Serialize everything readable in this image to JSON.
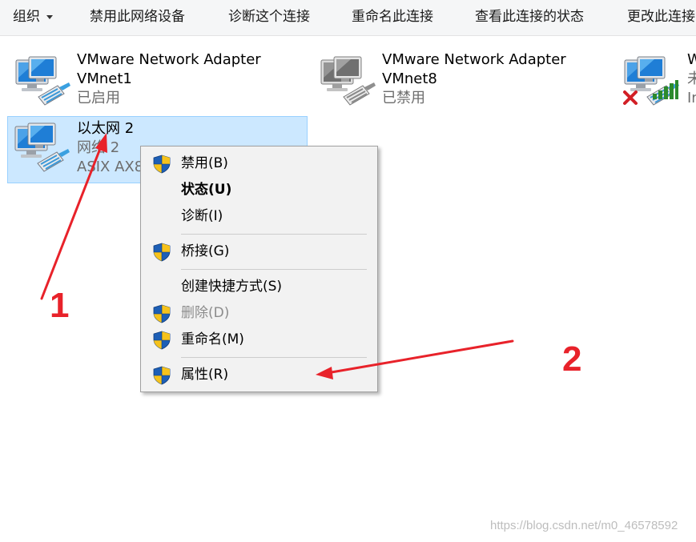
{
  "toolbar": {
    "organize": "组织",
    "disable": "禁用此网络设备",
    "diagnose": "诊断这个连接",
    "rename": "重命名此连接",
    "view_status": "查看此连接的状态",
    "change": "更改此连接"
  },
  "adapters": [
    {
      "name_line1": "VMware Network Adapter",
      "name_line2": "VMnet1",
      "status": "已启用"
    },
    {
      "name_line1": "VMware Network Adapter",
      "name_line2": "VMnet8",
      "status": "已禁用"
    },
    {
      "name_line1": "W",
      "status": "未",
      "detail": "In"
    },
    {
      "name": "以太网 2",
      "network": "网络 2",
      "device": "ASIX AX8"
    }
  ],
  "context_menu": {
    "items": [
      {
        "label": "禁用(B)",
        "shield": true
      },
      {
        "label": "状态(U)",
        "bold": true
      },
      {
        "label": "诊断(I)"
      },
      {
        "label": "桥接(G)",
        "shield": true
      },
      {
        "label": "创建快捷方式(S)"
      },
      {
        "label": "删除(D)",
        "shield": true,
        "disabled": true
      },
      {
        "label": "重命名(M)",
        "shield": true
      },
      {
        "label": "属性(R)",
        "shield": true
      }
    ]
  },
  "annotations": {
    "one": "1",
    "two": "2",
    "color": "#e8222a"
  },
  "watermark": "https://blog.csdn.net/m0_46578592",
  "colors": {
    "selection_bg": "#cce8ff",
    "selection_border": "#99d1ff",
    "menu_bg": "#f2f2f2"
  }
}
